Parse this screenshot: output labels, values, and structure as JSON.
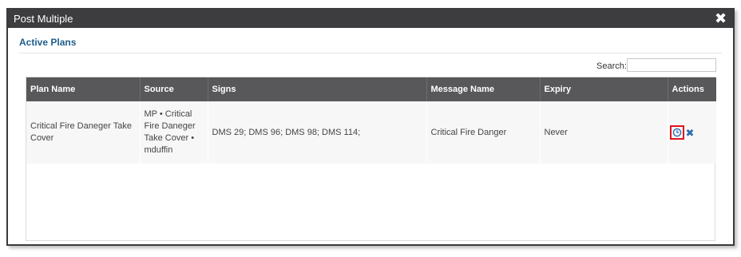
{
  "dialog": {
    "title": "Post Multiple",
    "close_icon": "close-icon"
  },
  "section": {
    "title": "Active Plans"
  },
  "search": {
    "label": "Search:",
    "value": "",
    "placeholder": ""
  },
  "table": {
    "columns": [
      "Plan Name",
      "Source",
      "Signs",
      "Message Name",
      "Expiry",
      "Actions"
    ],
    "rows": [
      {
        "plan_name": "Critical Fire Daneger Take Cover",
        "source": "MP • Critical Fire Daneger Take Cover • mduffin",
        "signs": "DMS 29; DMS 96; DMS 98; DMS 114;",
        "message_name": "Critical Fire Danger",
        "expiry": "Never",
        "actions": [
          "history-icon",
          "remove-icon"
        ]
      }
    ]
  },
  "colors": {
    "titlebar": "#3d3d40",
    "header": "#58585b",
    "section_title": "#1f5d8a",
    "highlight": "#e0141e",
    "action_icon": "#2b6fb0"
  }
}
